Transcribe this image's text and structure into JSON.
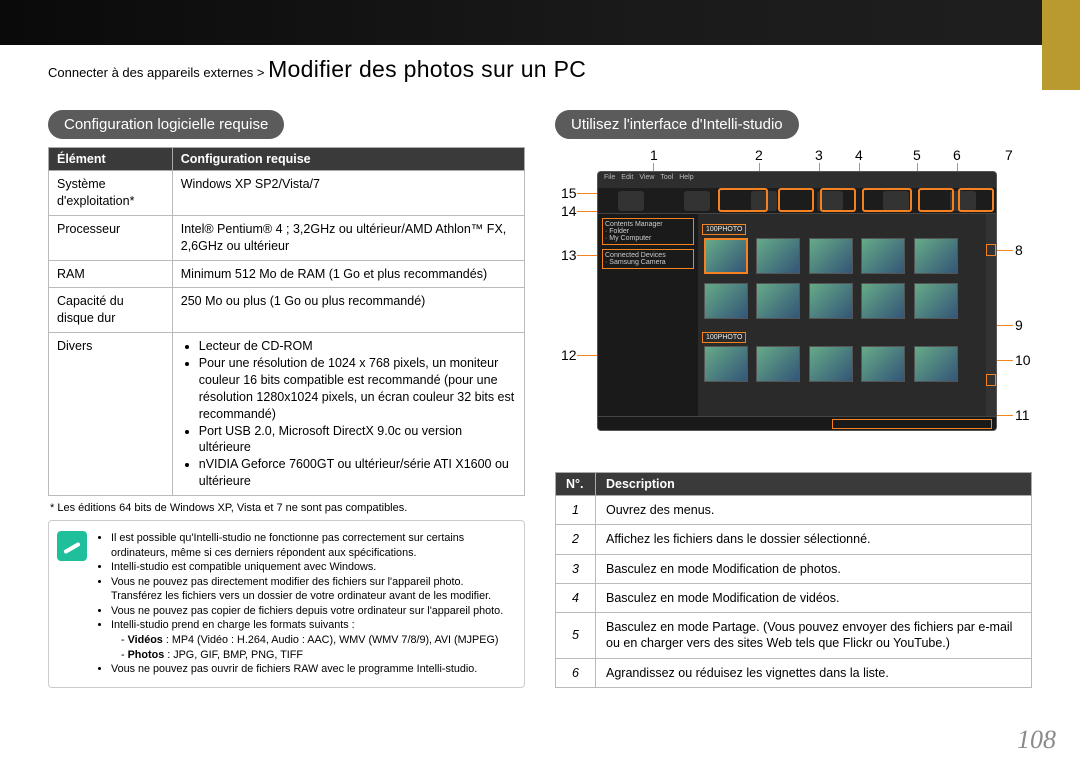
{
  "breadcrumb": {
    "prefix": "Connecter à des appareils externes > ",
    "title": "Modifier des photos sur un PC"
  },
  "left": {
    "heading": "Configuration logicielle requise",
    "th_element": "Élément",
    "th_config": "Configuration requise",
    "rows": {
      "os_label": "Système d'exploitation*",
      "os_val": "Windows XP SP2/Vista/7",
      "cpu_label": "Processeur",
      "cpu_val": "Intel® Pentium® 4 ; 3,2GHz ou ultérieur/AMD Athlon™ FX, 2,6GHz ou ultérieur",
      "ram_label": "RAM",
      "ram_val": "Minimum 512 Mo de RAM (1 Go et plus recommandés)",
      "hdd_label": "Capacité du disque dur",
      "hdd_val": "250 Mo ou plus (1 Go ou plus recommandé)",
      "divers_label": "Divers",
      "divers_items": [
        "Lecteur de CD-ROM",
        "Pour une résolution de 1024 x 768 pixels, un moniteur couleur 16 bits compatible est recommandé (pour une résolution 1280x1024 pixels, un écran couleur 32 bits est recommandé)",
        "Port USB 2.0, Microsoft DirectX 9.0c ou version ultérieure",
        "nVIDIA Geforce 7600GT ou ultérieur/série ATI X1600 ou ultérieure"
      ]
    },
    "footnote": "* Les éditions 64 bits de Windows XP, Vista et 7 ne sont pas compatibles.",
    "notes": {
      "n1": "Il est possible qu'Intelli-studio ne fonctionne pas correctement sur certains ordinateurs, même si ces derniers répondent aux spécifications.",
      "n2": "Intelli-studio est compatible uniquement avec Windows.",
      "n3": "Vous ne pouvez pas directement modifier des fichiers sur l'appareil photo. Transférez les fichiers vers un dossier de votre ordinateur avant de les modifier.",
      "n4": "Vous ne pouvez pas copier de fichiers depuis votre ordinateur sur l'appareil photo.",
      "n5": "Intelli-studio prend en charge les formats suivants :",
      "n5a_label": "Vidéos",
      "n5a_val": " : MP4 (Vidéo : H.264, Audio : AAC), WMV (WMV 7/8/9), AVI (MJPEG)",
      "n5b_label": "Photos",
      "n5b_val": " : JPG, GIF, BMP, PNG, TIFF",
      "n6": "Vous ne pouvez pas ouvrir de fichiers RAW avec le programme Intelli-studio."
    }
  },
  "right": {
    "heading": "Utilisez l'interface d'Intelli-studio",
    "callouts": {
      "c1": "1",
      "c2": "2",
      "c3": "3",
      "c4": "4",
      "c5": "5",
      "c6": "6",
      "c7": "7",
      "c8": "8",
      "c9": "9",
      "c10": "10",
      "c11": "11",
      "c12": "12",
      "c13": "13",
      "c14": "14",
      "c15": "15"
    },
    "th_no": "N°.",
    "th_desc": "Description",
    "drows": {
      "d1": "Ouvrez des menus.",
      "d2": "Affichez les fichiers dans le dossier sélectionné.",
      "d3": "Basculez en mode Modification de photos.",
      "d4": "Basculez en mode Modification de vidéos.",
      "d5": "Basculez en mode Partage. (Vous pouvez envoyer des fichiers par e-mail ou en charger vers des sites Web tels que Flickr ou YouTube.)",
      "d6": "Agrandissez ou réduisez les vignettes dans la liste."
    }
  },
  "page_number": "108"
}
